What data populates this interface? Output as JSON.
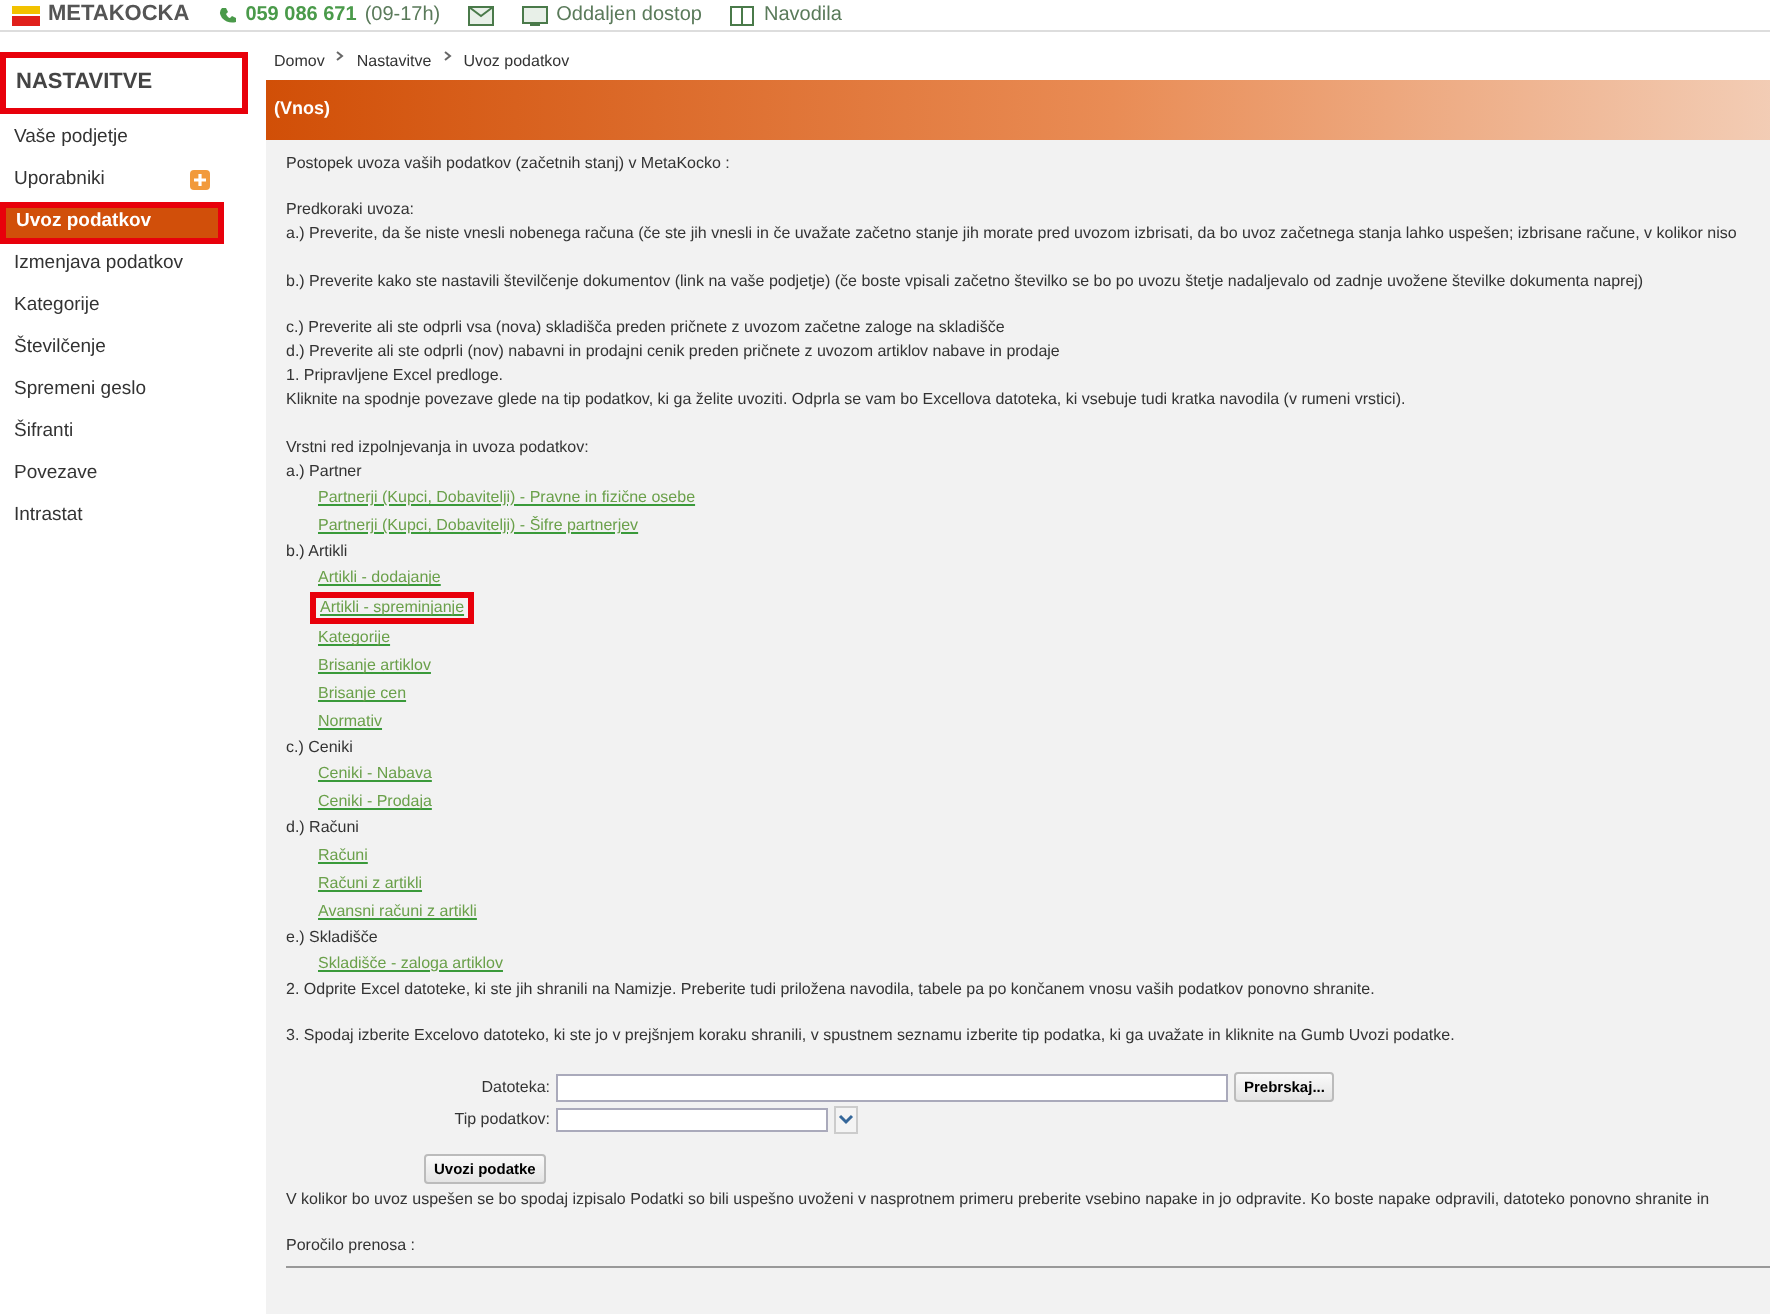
{
  "header": {
    "logo": "METAKOCKA",
    "phone": "059 086 671",
    "hours": "(09-17h)",
    "links": [
      "Oddaljen dostop",
      "Navodila"
    ]
  },
  "sidebar": {
    "title": "NASTAVITVE",
    "title_highlighted": true,
    "items": [
      {
        "label": "Vaše podjetje",
        "selected": false,
        "highlighted": false,
        "has_add": false
      },
      {
        "label": "Uporabniki",
        "selected": false,
        "highlighted": false,
        "has_add": true
      },
      {
        "label": "Uvoz podatkov",
        "selected": true,
        "highlighted": true,
        "has_add": false
      },
      {
        "label": "Izmenjava podatkov",
        "selected": false,
        "highlighted": false,
        "has_add": false
      },
      {
        "label": "Kategorije",
        "selected": false,
        "highlighted": false,
        "has_add": false
      },
      {
        "label": "Številčenje",
        "selected": false,
        "highlighted": false,
        "has_add": false
      },
      {
        "label": "Spremeni geslo",
        "selected": false,
        "highlighted": false,
        "has_add": false
      },
      {
        "label": "Šifranti",
        "selected": false,
        "highlighted": false,
        "has_add": false
      },
      {
        "label": "Povezave",
        "selected": false,
        "highlighted": false,
        "has_add": false
      },
      {
        "label": "Intrastat",
        "selected": false,
        "highlighted": false,
        "has_add": false
      }
    ]
  },
  "breadcrumb": [
    "Domov",
    "Nastavitve",
    "Uvoz podatkov"
  ],
  "section_title": "(Vnos)",
  "blocks": [
    {
      "kind": "para",
      "space_before": false,
      "text": "Postopek uvoza vaših podatkov (začetnih stanj) v MetaKocko :"
    },
    {
      "kind": "para",
      "space_before": true,
      "text": "Predkoraki uvoza:"
    },
    {
      "kind": "para",
      "space_before": false,
      "text": "a.) Preverite, da še niste vnesli nobenega računa (če ste jih vnesli in če uvažate začetno stanje jih morate pred uvozom izbrisati, da bo uvoz začetnega stanja lahko uspešen; izbrisane račune, v kolikor niso"
    },
    {
      "kind": "para",
      "space_before": true,
      "text": "b.) Preverite kako ste nastavili številčenje dokumentov (link na vaše podjetje) (če boste vpisali začetno številko se bo po uvozu štetje nadaljevalo od zadnje uvožene številke dokumenta naprej)"
    },
    {
      "kind": "para",
      "space_before": true,
      "text": "c.) Preverite ali ste odprli vsa (nova) skladišča preden pričnete z uvozom začetne zaloge na skladišče"
    },
    {
      "kind": "para",
      "space_before": false,
      "text": "d.) Preverite ali ste odprli (nov) nabavni in prodajni cenik preden pričnete z uvozom artiklov nabave in prodaje"
    },
    {
      "kind": "para",
      "space_before": false,
      "text": "1. Pripravljene Excel predloge."
    },
    {
      "kind": "para",
      "space_before": false,
      "text": "Kliknite na spodnje povezave glede na tip podatkov, ki ga želite uvoziti. Odprla se vam bo Excellova datoteka, ki vsebuje tudi kratka navodila (v rumeni vrstici)."
    },
    {
      "kind": "para",
      "space_before": true,
      "text": "Vrstni red izpolnjevanja in uvoza podatkov:"
    },
    {
      "kind": "group",
      "label": "a.) Partner",
      "links": [
        {
          "label": "Partnerji (Kupci, Dobavitelji) - Pravne in fizične osebe",
          "highlighted": false
        },
        {
          "label": "Partnerji (Kupci, Dobavitelji) - Šifre partnerjev",
          "highlighted": false
        }
      ]
    },
    {
      "kind": "group",
      "label": "b.) Artikli",
      "links": [
        {
          "label": "Artikli - dodajanje",
          "highlighted": false
        },
        {
          "label": "Artikli - spreminjanje",
          "highlighted": true
        },
        {
          "label": "Kategorije",
          "highlighted": false
        },
        {
          "label": "Brisanje artiklov",
          "highlighted": false
        },
        {
          "label": "Brisanje cen",
          "highlighted": false
        },
        {
          "label": "Normativ",
          "highlighted": false
        }
      ]
    },
    {
      "kind": "group",
      "label": "c.) Ceniki",
      "links": [
        {
          "label": "Ceniki - Nabava",
          "highlighted": false
        },
        {
          "label": "Ceniki - Prodaja",
          "highlighted": false
        }
      ]
    },
    {
      "kind": "group",
      "label": "d.) Računi",
      "links": [
        {
          "label": "Računi",
          "highlighted": false
        },
        {
          "label": "Računi z artikli",
          "highlighted": false
        },
        {
          "label": "Avansni računi z artikli",
          "highlighted": false
        }
      ]
    },
    {
      "kind": "group",
      "label": "e.) Skladišče",
      "links": [
        {
          "label": "Skladišče - zaloga artiklov",
          "highlighted": false
        }
      ]
    },
    {
      "kind": "para",
      "space_before": false,
      "text": "2. Odprite Excel datoteke, ki ste jih shranili na Namizje. Preberite tudi priložena navodila, tabele pa po končanem vnosu vaših podatkov ponovno shranite."
    },
    {
      "kind": "para",
      "space_before": true,
      "text": "3. Spodaj izberite Excelovo datoteko, ki ste jo v prejšnjem koraku shranili, v spustnem seznamu izberite tip podatka, ki ga uvažate in kliknite na Gumb Uvozi podatke."
    },
    {
      "kind": "form",
      "file_label": "Datoteka:",
      "browse": "Prebrskaj...",
      "type_label": "Tip podatkov:",
      "submit": "Uvozi podatke"
    },
    {
      "kind": "para",
      "space_before": false,
      "text": "V kolikor bo uvoz uspešen se bo spodaj izpisalo Podatki so bili uspešno uvoženi v nasprotnem primeru preberite vsebino napake in jo odpravite. Ko boste napake odpravili, datoteko ponovno shranite in"
    },
    {
      "kind": "para",
      "space_before": true,
      "text": "Poročilo prenosa :"
    },
    {
      "kind": "rule"
    }
  ]
}
